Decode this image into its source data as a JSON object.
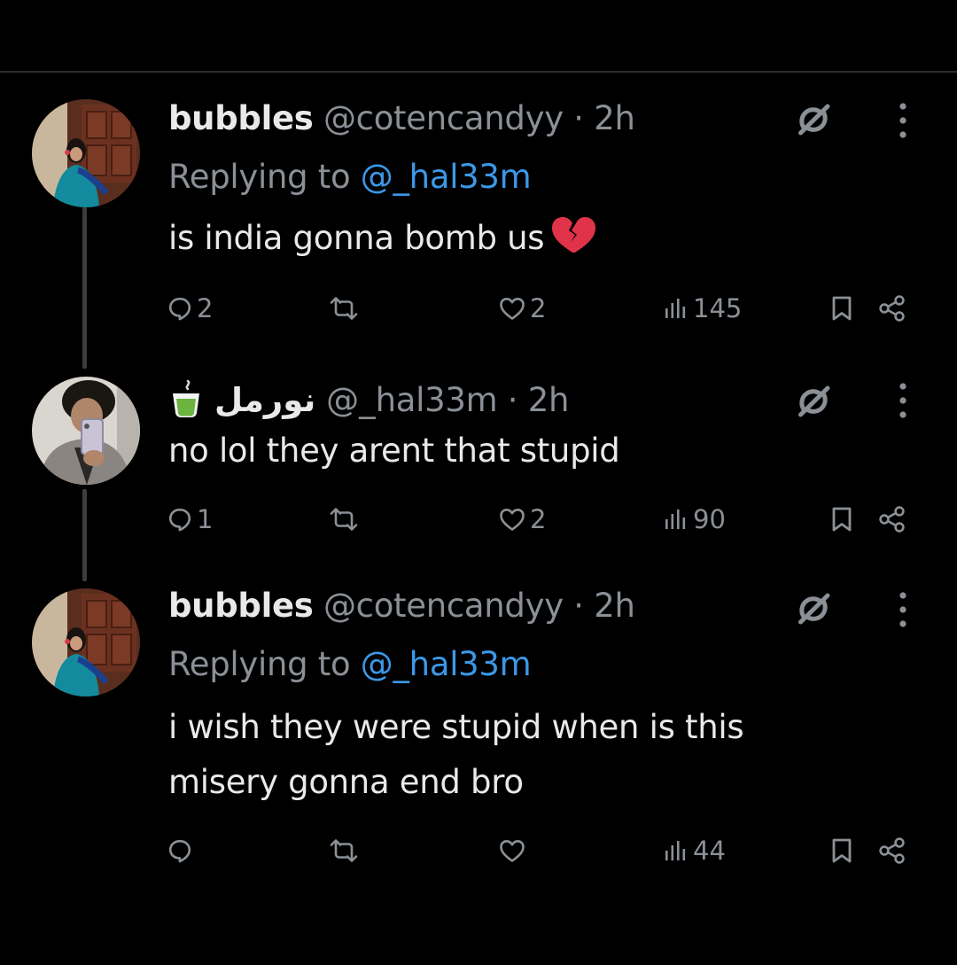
{
  "colors": {
    "background": "#000000",
    "text": "#e7e9ea",
    "muted": "#8b9096",
    "mention": "#3b98e8",
    "thread_line": "#3a3d40"
  },
  "tweets": [
    {
      "display_name": "bubbles",
      "handle": "@cotencandyy",
      "separator": "·",
      "time": "2h",
      "replying_prefix": "Replying to",
      "replying_to": "@_hal33m",
      "text": "is india gonna bomb us",
      "emoji": "broken-heart-icon",
      "replies": "2",
      "reposts": "",
      "likes": "2",
      "views": "145"
    },
    {
      "display_name": "نورمل",
      "display_emoji": "green-tea-cup-icon",
      "handle": "@_hal33m",
      "separator": "·",
      "time": "2h",
      "text": "no lol they arent that stupid",
      "replies": "1",
      "reposts": "",
      "likes": "2",
      "views": "90"
    },
    {
      "display_name": "bubbles",
      "handle": "@cotencandyy",
      "separator": "·",
      "time": "2h",
      "replying_prefix": "Replying to",
      "replying_to": "@_hal33m",
      "text_line1": "i wish they were stupid when is this",
      "text_line2": "misery gonna end bro",
      "replies": "",
      "reposts": "",
      "likes": "",
      "views": "44"
    }
  ]
}
